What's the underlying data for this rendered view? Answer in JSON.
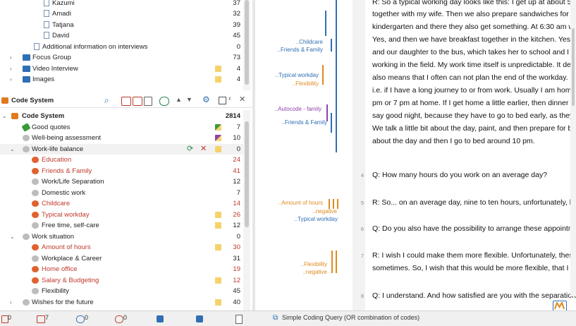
{
  "doc_tree": [
    {
      "label": "Kazumi",
      "count": "37"
    },
    {
      "label": "Amadi",
      "count": "32"
    },
    {
      "label": "Tatjana",
      "count": "39"
    },
    {
      "label": "David",
      "count": "45"
    },
    {
      "label": "Additional information on interviews",
      "count": "0"
    },
    {
      "label": "Focus Group",
      "count": "73"
    },
    {
      "label": "Video Interview",
      "count": "4"
    },
    {
      "label": "Images",
      "count": "4"
    }
  ],
  "code_system_panel": {
    "title": "Code System"
  },
  "code_tree": [
    {
      "label": "Code System",
      "count": "2814"
    },
    {
      "label": "Good quotes",
      "count": "7"
    },
    {
      "label": "Well-being assessment",
      "count": "10"
    },
    {
      "label": "Work-life balance",
      "count": "0"
    },
    {
      "label": "Education",
      "count": "24"
    },
    {
      "label": "Friends & Family",
      "count": "41"
    },
    {
      "label": "Work/Life Separation",
      "count": "12"
    },
    {
      "label": "Domestic work",
      "count": "7"
    },
    {
      "label": "Childcare",
      "count": "14"
    },
    {
      "label": "Typical workday",
      "count": "26"
    },
    {
      "label": "Free time, self-care",
      "count": "12"
    },
    {
      "label": "Work situation",
      "count": "0"
    },
    {
      "label": "Amount of hours",
      "count": "30"
    },
    {
      "label": "Workplace & Career",
      "count": "31"
    },
    {
      "label": "Home office",
      "count": "19"
    },
    {
      "label": "Salary & Budgeting",
      "count": "12"
    },
    {
      "label": "Flexibility",
      "count": "45"
    },
    {
      "label": "Wishes for the future",
      "count": "40"
    }
  ],
  "coding_stripe_labels": [
    {
      "label": "..Childcare"
    },
    {
      "label": "..Friends & Family"
    },
    {
      "label": "..Typical workday"
    },
    {
      "label": "..Flexibility"
    },
    {
      "label": "..Autocode - family"
    },
    {
      "label": "..Friends & Family"
    },
    {
      "label": "..Amount of hours"
    },
    {
      "label": "..negative"
    },
    {
      "label": "..Typical workday"
    },
    {
      "label": "..Flexibility"
    },
    {
      "label": "..negative"
    }
  ],
  "transcript": [
    {
      "line": "",
      "text": "R: So a typical working day looks like this: I get up at about 5:"
    },
    {
      "line": "",
      "text": "together with my wife. Then we also prepare sandwiches for o"
    },
    {
      "line": "",
      "text": "kindergarten and there they also get something. At 6:30 am w"
    },
    {
      "line": "",
      "text": "Yes, and then we have breakfast together in the kitchen. Yes,"
    },
    {
      "line": "",
      "text": "and our daughter to the bus, which takes her to school and I g"
    },
    {
      "line": "",
      "text": "working in the field. My work time itself is unpredictable. It dep"
    },
    {
      "line": "",
      "text": "also means that I often can not plan the end of the workday. E"
    },
    {
      "line": "",
      "text": "i.e. if I have a long journey to or from work. Usually I am hom"
    },
    {
      "line": "",
      "text": "pm or 7 pm at home. If I get home a little earlier, then dinner is"
    },
    {
      "line": "",
      "text": "say good night, because they have to go to bed early, as they"
    },
    {
      "line": "",
      "text": "We talk a little bit about the day, paint, and then prepare for b"
    },
    {
      "line": "",
      "text": "about the day and then I go to bed around 10 pm."
    },
    {
      "line": "4",
      "text": "Q: How many hours do you work on an average day?"
    },
    {
      "line": "5",
      "text": "R: So... on an average day, nine to ten hours, unfortunately, be"
    },
    {
      "line": "6",
      "text": "Q: Do you also have the possibility to arrange these appointm"
    },
    {
      "line": "7",
      "text": "R: I wish I could make them more flexible. Unfortunately, these"
    },
    {
      "line": "",
      "text": "sometimes. So, I wish that this would be more flexible, that I c"
    },
    {
      "line": "8",
      "text": "Q: I understand. And how satisfied are you with the separation"
    }
  ],
  "status_bar": [
    {
      "value": "0"
    },
    {
      "value": "7"
    },
    {
      "value": "0"
    },
    {
      "value": "0"
    },
    {
      "value": "Simple Coding Query (OR combination of codes)"
    }
  ],
  "colors": {
    "orange": "#e08a1e",
    "blue": "#2f6fb3",
    "purple": "#8e44ad",
    "red": "#c0392b",
    "yellow": "#f5d36b"
  }
}
